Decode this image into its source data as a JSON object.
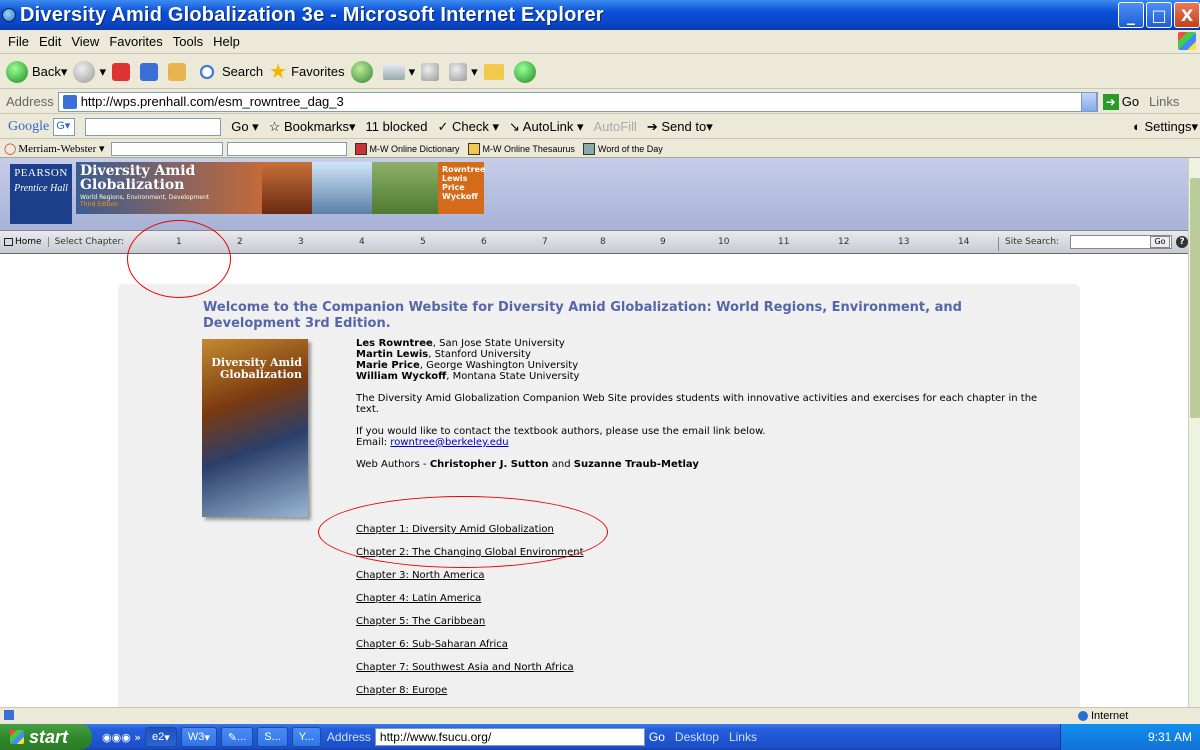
{
  "window": {
    "title": "Diversity Amid Globalization 3e - Microsoft Internet Explorer",
    "buttons": [
      "_",
      "□",
      "X"
    ]
  },
  "menu": [
    "File",
    "Edit",
    "View",
    "Favorites",
    "Tools",
    "Help"
  ],
  "toolbar": {
    "back": "Back",
    "search": "Search",
    "favorites": "Favorites"
  },
  "address": {
    "label": "Address",
    "url": "http://wps.prenhall.com/esm_rowntree_dag_3",
    "go": "Go",
    "links": "Links"
  },
  "google_bar": {
    "logo": "Google",
    "go": "Go",
    "bookmarks": "Bookmarks",
    "blocked": "11 blocked",
    "check": "Check",
    "autolink": "AutoLink",
    "autofill": "AutoFill",
    "send_to": "Send to",
    "settings": "Settings"
  },
  "mw_bar": {
    "label": "Merriam-Webster",
    "links": [
      "M-W Online Dictionary",
      "M-W Online Thesaurus",
      "Word of the Day"
    ]
  },
  "banner": {
    "publisher_1": "PEARSON",
    "publisher_2": "Prentice Hall",
    "book_title": "Diversity Amid Globalization",
    "book_subtitle": "World Regions, Environment, Development",
    "edition": "Third Edition",
    "authors": [
      "Rowntree",
      "Lewis",
      "Price",
      "Wyckoff"
    ]
  },
  "chapter_nav": {
    "home": "Home",
    "select": "Select Chapter:",
    "numbers": [
      "1",
      "2",
      "3",
      "4",
      "5",
      "6",
      "7",
      "8",
      "9",
      "10",
      "11",
      "12",
      "13",
      "14"
    ],
    "site_search": "Site Search:",
    "go": "Go",
    "help": "?"
  },
  "content": {
    "welcome": "Welcome to the Companion Website for Diversity Amid Globalization: World Regions, Environment, and Development 3rd Edition.",
    "cover_title": "Diversity Amid Globalization",
    "authors": [
      {
        "name": "Les Rowntree",
        "affil": ", San Jose State University"
      },
      {
        "name": "Martin Lewis",
        "affil": ", Stanford University"
      },
      {
        "name": "Marie Price",
        "affil": ", George Washington University"
      },
      {
        "name": "William Wyckoff",
        "affil": ", Montana State University"
      }
    ],
    "description": "The Diversity Amid Globalization Companion Web Site provides students with innovative activities and exercises for each chapter in the text.",
    "contact": "If you would like to contact the textbook authors, please use the email link below.",
    "email_label": "Email: ",
    "email": "rowntree@berkeley.edu",
    "web_authors_label": "Web Authors - ",
    "web_author_1": "Christopher J. Sutton",
    "and": " and ",
    "web_author_2": "Suzanne Traub-Metlay",
    "chapters": [
      "Chapter 1: Diversity Amid Globalization",
      "Chapter 2: The Changing Global Environment",
      "Chapter 3: North America",
      "Chapter 4: Latin America",
      "Chapter 5: The Caribbean",
      "Chapter 6: Sub-Saharan Africa",
      "Chapter 7: Southwest Asia and North Africa",
      "Chapter 8: Europe"
    ]
  },
  "status": {
    "zone": "Internet"
  },
  "taskbar": {
    "start": "start",
    "buttons": [
      "2",
      "3",
      "...",
      "S...",
      "Y..."
    ],
    "address_label": "Address",
    "address_url": "http://www.fsucu.org/",
    "go": "Go",
    "desktop": "Desktop",
    "links": "Links",
    "time": "9:31 AM"
  }
}
